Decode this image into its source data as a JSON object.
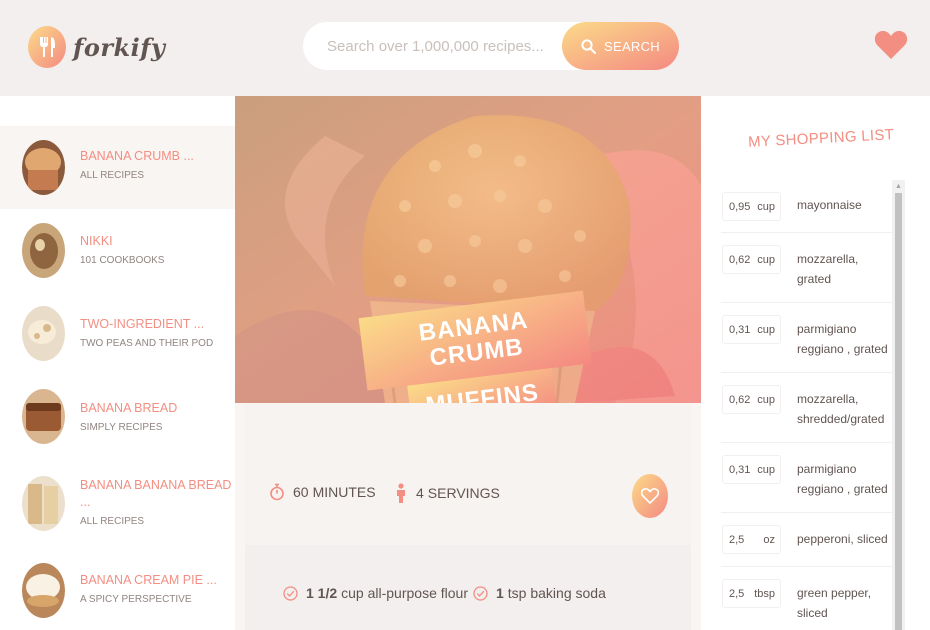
{
  "header": {
    "logo_text": "forkify",
    "search_placeholder": "Search over 1,000,000 recipes...",
    "search_button": "SEARCH"
  },
  "results": [
    {
      "title": "BANANA CRUMB ...",
      "publisher": "ALL RECIPES",
      "active": true
    },
    {
      "title": "NIKKI",
      "publisher": "101 COOKBOOKS"
    },
    {
      "title": "TWO-INGREDIENT ...",
      "publisher": "TWO PEAS AND THEIR POD"
    },
    {
      "title": "BANANA BREAD",
      "publisher": "SIMPLY RECIPES"
    },
    {
      "title": "BANANA BANANA BREAD",
      "title2": "...",
      "publisher": "ALL RECIPES"
    },
    {
      "title": "BANANA CREAM PIE ...",
      "publisher": "A SPICY PERSPECTIVE"
    }
  ],
  "recipe": {
    "title_line1": "BANANA CRUMB",
    "title_line2": "MUFFINS",
    "minutes": "60",
    "minutes_label": "MINUTES",
    "servings": "4",
    "servings_label": "SERVINGS",
    "ingredients": [
      {
        "count": "1 1/2",
        "text": "cup all-purpose flour"
      },
      {
        "count": "1",
        "text": "tsp baking soda"
      }
    ]
  },
  "shopping": {
    "title": "MY SHOPPING LIST",
    "items": [
      {
        "count": "0,95",
        "unit": "cup",
        "desc": "mayonnaise"
      },
      {
        "count": "0,62",
        "unit": "cup",
        "desc": "mozzarella, grated"
      },
      {
        "count": "0,31",
        "unit": "cup",
        "desc": "parmigiano reggiano , grated"
      },
      {
        "count": "0,62",
        "unit": "cup",
        "desc": "mozzarella, shredded/grated"
      },
      {
        "count": "0,31",
        "unit": "cup",
        "desc": "parmigiano reggiano , grated"
      },
      {
        "count": "2,5",
        "unit": "oz",
        "desc": "pepperoni, sliced"
      },
      {
        "count": "2,5",
        "unit": "tbsp",
        "desc": "green pepper, sliced"
      }
    ]
  },
  "colors": {
    "accent": "#f38e82",
    "gradient_start": "#fbdb89",
    "gradient_end": "#f48982",
    "text": "#615551"
  }
}
